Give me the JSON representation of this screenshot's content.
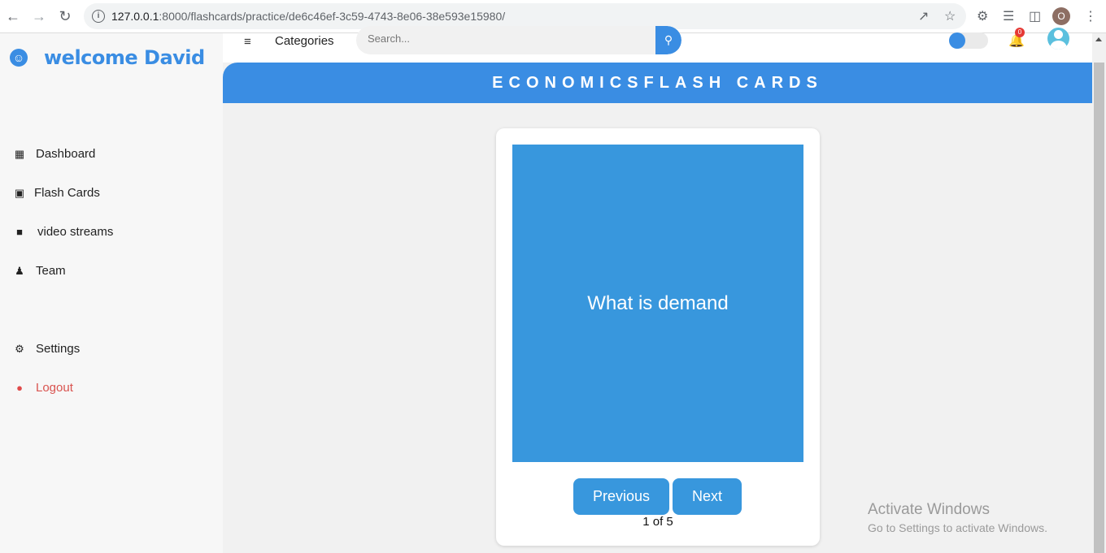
{
  "browser": {
    "url_host": "127.0.0.1",
    "url_rest": ":8000/flashcards/practice/de6c46ef-3c59-4743-8e06-38e593e15980/",
    "profile_initial": "O"
  },
  "sidebar": {
    "welcome": "welcome David",
    "items": [
      {
        "label": "Dashboard",
        "icon": "dashboard-icon"
      },
      {
        "label": "Flash Cards",
        "icon": "flashcards-icon"
      },
      {
        "label": "video streams",
        "icon": "video-icon"
      },
      {
        "label": "Team",
        "icon": "team-icon"
      },
      {
        "label": "Settings",
        "icon": "gear-icon"
      },
      {
        "label": "Logout",
        "icon": "logout-icon"
      }
    ]
  },
  "header": {
    "categories": "Categories",
    "search_placeholder": "Search...",
    "notification_count": "0"
  },
  "banner": {
    "title": "ECONOMICSFLASH CARDS"
  },
  "card": {
    "question": "What is demand",
    "prev_label": "Previous",
    "next_label": "Next",
    "counter": "1 of 5"
  },
  "watermark": {
    "line1": "Activate Windows",
    "line2": "Go to Settings to activate Windows."
  },
  "colors": {
    "accent": "#3a8de3",
    "card_face": "#3897dd",
    "logout": "#d9534f"
  }
}
